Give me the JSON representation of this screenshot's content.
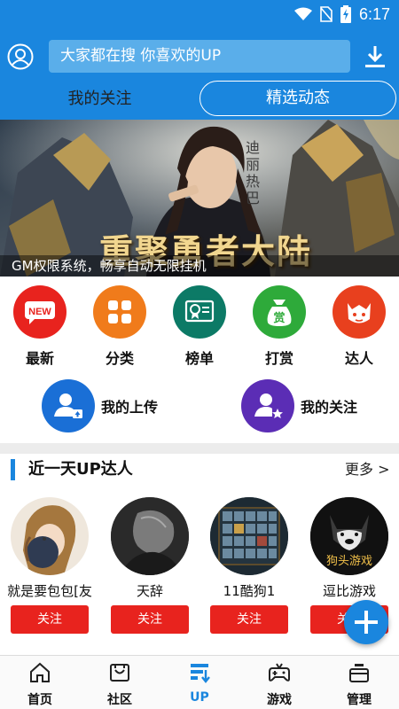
{
  "status_bar": {
    "time": "6:17"
  },
  "header": {
    "search_placeholder": "大家都在搜 你喜欢的UP",
    "tabs": [
      {
        "label": "我的关注",
        "active": false
      },
      {
        "label": "精选动态",
        "active": true
      }
    ]
  },
  "banner": {
    "headline": "重聚勇者大陆",
    "signature": "迪丽热巴",
    "caption": "GM权限系统，畅享自动无限挂机"
  },
  "categories": [
    {
      "label": "最新",
      "icon": "new-badge-icon",
      "color": "#e8231e",
      "badge": "NEW"
    },
    {
      "label": "分类",
      "icon": "grid-icon",
      "color": "#f07b1b"
    },
    {
      "label": "榜单",
      "icon": "certificate-icon",
      "color": "#0c7a66"
    },
    {
      "label": "打赏",
      "icon": "reward-bag-icon",
      "color": "#2eaa3a",
      "badge": "赏"
    },
    {
      "label": "达人",
      "icon": "expert-face-icon",
      "color": "#e8401e"
    }
  ],
  "quick_links": [
    {
      "label": "我的上传",
      "icon": "user-upload-icon",
      "color": "#1a6fd6"
    },
    {
      "label": "我的关注",
      "icon": "user-star-icon",
      "color": "#5b2db5"
    }
  ],
  "up_section": {
    "title": "近一天UP达人",
    "more": "更多 >",
    "follow_label": "关注",
    "users": [
      {
        "name": "就是要包包[友"
      },
      {
        "name": "天辞"
      },
      {
        "name": "11酷狗1"
      },
      {
        "name": "逗比游戏",
        "avatar_text": "狗头游戏"
      }
    ]
  },
  "bottom_nav": [
    {
      "label": "首页",
      "icon": "home-icon",
      "active": false
    },
    {
      "label": "社区",
      "icon": "community-icon",
      "active": false
    },
    {
      "label": "UP",
      "icon": "up-icon",
      "active": true
    },
    {
      "label": "游戏",
      "icon": "gamepad-icon",
      "active": false
    },
    {
      "label": "管理",
      "icon": "manage-icon",
      "active": false
    }
  ],
  "colors": {
    "brand_blue": "#1a86de",
    "follow_red": "#e8231e"
  }
}
